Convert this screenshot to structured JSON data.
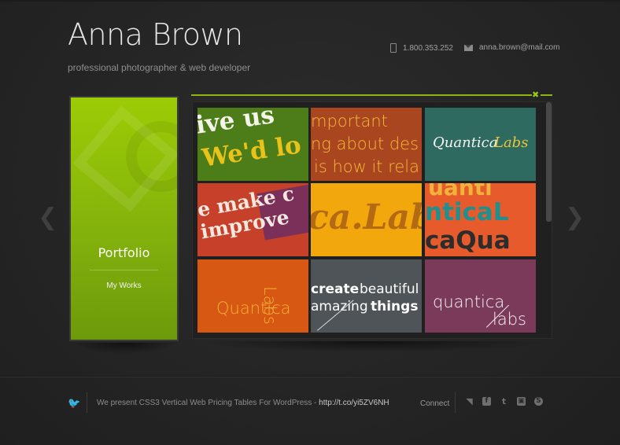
{
  "header": {
    "title": "Anna Brown",
    "tagline": "professional photographer & web developer",
    "phone": "1.800.353.252",
    "email": "anna.brown@mail.com",
    "icons": {
      "phone": "phone-icon",
      "email": "mail-icon"
    }
  },
  "nav": {
    "prev_glyph": "❮",
    "next_glyph": "❯"
  },
  "portfolio_tile": {
    "title": "Portfolio",
    "subtitle": "My Works",
    "color": "#8fc107"
  },
  "gallery": {
    "accent_color": "#8fb60d",
    "close_glyph": "✖",
    "thumbnails": [
      {
        "lines": [
          "ive us",
          "We'd lo"
        ]
      },
      {
        "lines": [
          "mportant",
          "ng about des",
          "is how it rela"
        ]
      },
      {
        "lines": [
          "Quantica",
          "Labs"
        ]
      },
      {
        "lines": [
          "e make c",
          "improve"
        ]
      },
      {
        "lines": [
          "ca.Lab"
        ]
      },
      {
        "lines": [
          "uanti",
          "nticaL",
          "caQua"
        ]
      },
      {
        "lines": [
          "Quantica",
          "Labs"
        ]
      },
      {
        "lines": [
          "create",
          "beautiful",
          "amazing",
          "things"
        ]
      },
      {
        "lines": [
          "quantica",
          "labs"
        ]
      }
    ]
  },
  "footer": {
    "tweet_text": "We present CSS3 Vertical Web Pricing Tables For WordPress - ",
    "tweet_link": "http://t.co/yi5ZV6NH",
    "connect_label": "Connect",
    "social_icons": [
      "rss-icon",
      "facebook-icon",
      "twitter-icon",
      "stumbleupon-icon",
      "skype-icon"
    ],
    "social_glyphs": [
      "◥",
      "f",
      "t",
      "▣",
      "S"
    ],
    "twitter_glyph": "🐦"
  }
}
